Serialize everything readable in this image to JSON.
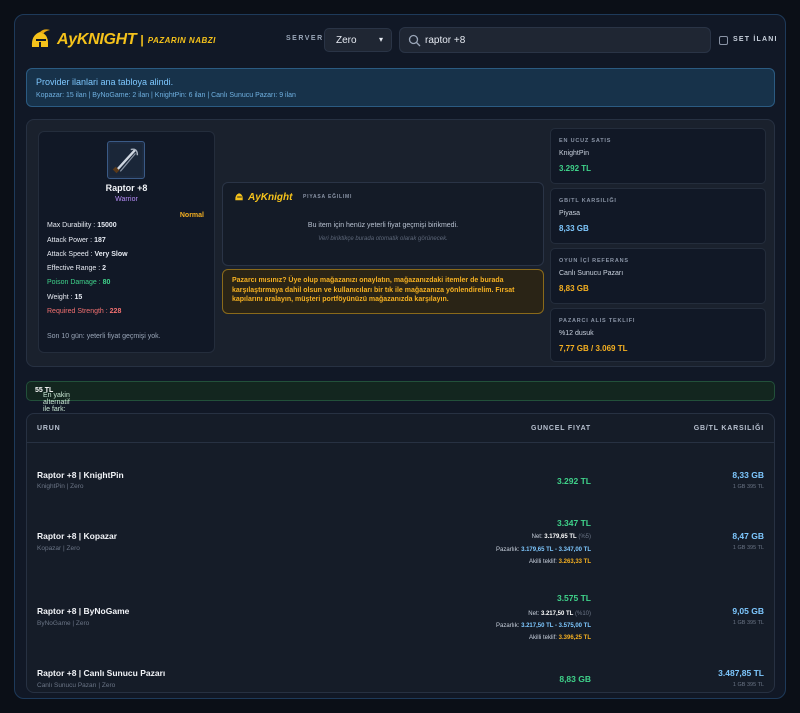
{
  "header": {
    "brand": "AyKNIGHT",
    "separator": "|",
    "brand_sub": "PAZARIN NABZI",
    "server_label": "SERVER",
    "server_value": "Zero",
    "search_value": "raptor +8",
    "set_label": "SET İLANI"
  },
  "provider": {
    "title": "Provider ilanlari ana tabloya alindi.",
    "detail": "Kopazar: 15 ilan | ByNoGame: 2 ilan | KnightPin: 6 ilan | Canlı Sunucu Pazarı: 9 ilan"
  },
  "item": {
    "name": "Raptor +8",
    "class": "Warrior",
    "grade": "Normal",
    "stats": [
      {
        "label": "Max Durability : ",
        "value": "15000",
        "tone": "normal"
      },
      {
        "label": "Attack Power : ",
        "value": "187",
        "tone": "normal"
      },
      {
        "label": "Attack Speed : ",
        "value": "Very Slow",
        "tone": "normal"
      },
      {
        "label": "Effective Range : ",
        "value": "2",
        "tone": "normal"
      },
      {
        "label": "Poison Damage : ",
        "value": "80",
        "tone": "green"
      },
      {
        "label": "Weight : ",
        "value": "15",
        "tone": "normal"
      },
      {
        "label": "Required Strength : ",
        "value": "228",
        "tone": "red"
      }
    ],
    "history": "Son 10 gün: yeterli fiyat geçmişi yok."
  },
  "market": {
    "brand": "AyKnight",
    "label": "PIYASA EĞILIMI",
    "message": "Bu item için henüz yeterli fiyat geçmişi birikmedi.",
    "hint": "Veri biriktikçe burada otomatik olarak görünecek."
  },
  "promo": {
    "text": "Pazarcı mısınız? Üye olup mağazanızı onaylatın, mağazanızdaki itemler de burada karşılaştırmaya dahil olsun ve kullanıcıları bir tık ile mağazanıza yönlendirelim. Fırsat kapılarını aralayın, müşteri portföyünüzü mağazanızda karşılayın."
  },
  "stat_cards": [
    {
      "label": "EN UCUZ SATIS",
      "sub": "KnightPin",
      "value": "3.292 TL",
      "color": "#3fd28a"
    },
    {
      "label": "GB/TL KARSILIĞI",
      "sub": "Piyasa",
      "value": "8,33 GB",
      "color": "#7ec8ff"
    },
    {
      "label": "OYUN İÇİ REFERANS",
      "sub": "Canlı Sunucu Pazarı",
      "value": "8,83 GB",
      "color": "#f5b021"
    },
    {
      "label": "PAZARCI ALIS TEKLIFI",
      "sub": "%12 dusuk",
      "value": "7,77 GB / 3.069 TL",
      "color": "#f5b021"
    }
  ],
  "diff": {
    "label": "En yakin alternatif ile fark: ",
    "value": "55 TL"
  },
  "table": {
    "headers": {
      "product": "URUN",
      "price": "GUNCEL FIYAT",
      "gb": "GB/TL KARSILIĞI"
    },
    "rows": [
      {
        "name": "Raptor +8 | KnightPin",
        "sub": "KnightPin | Zero",
        "price": "3.292 TL",
        "gb": "8,33 GB",
        "gb_sub": "1 GB 395 TL"
      },
      {
        "name": "Raptor +8 | Kopazar",
        "sub": "Kopazar | Zero",
        "price": "3.347 TL",
        "net_label": "Net: ",
        "net": "3.179,65 TL",
        "net_pct": " (%5)",
        "pazarlik_label": "Pazarlık: ",
        "pazarlik": "3.179,65 TL - 3.347,00 TL",
        "akilli_label": "Akilli teklif: ",
        "akilli": "3.263,33 TL",
        "gb": "8,47 GB",
        "gb_sub": "1 GB 395 TL"
      },
      {
        "name": "Raptor +8 | ByNoGame",
        "sub": "ByNoGame | Zero",
        "price": "3.575 TL",
        "net_label": "Net: ",
        "net": "3.217,50 TL",
        "net_pct": " (%10)",
        "pazarlik_label": "Pazarlık: ",
        "pazarlik": "3.217,50 TL - 3.575,00 TL",
        "akilli_label": "Akilli teklif: ",
        "akilli": "3.396,25 TL",
        "gb": "9,05 GB",
        "gb_sub": "1 GB 395 TL"
      },
      {
        "name": "Raptor +8 | Canlı Sunucu Pazarı",
        "sub": "Canlı Sunucu Pazarı | Zero",
        "price": "8,83 GB",
        "gb": "3.487,85 TL",
        "gb_sub": "1 GB 395 TL"
      }
    ]
  },
  "icons": {
    "logo": "knight-helmet-icon",
    "search": "search-icon",
    "item": "sword-icon",
    "chevron": "chevron-down-icon"
  }
}
